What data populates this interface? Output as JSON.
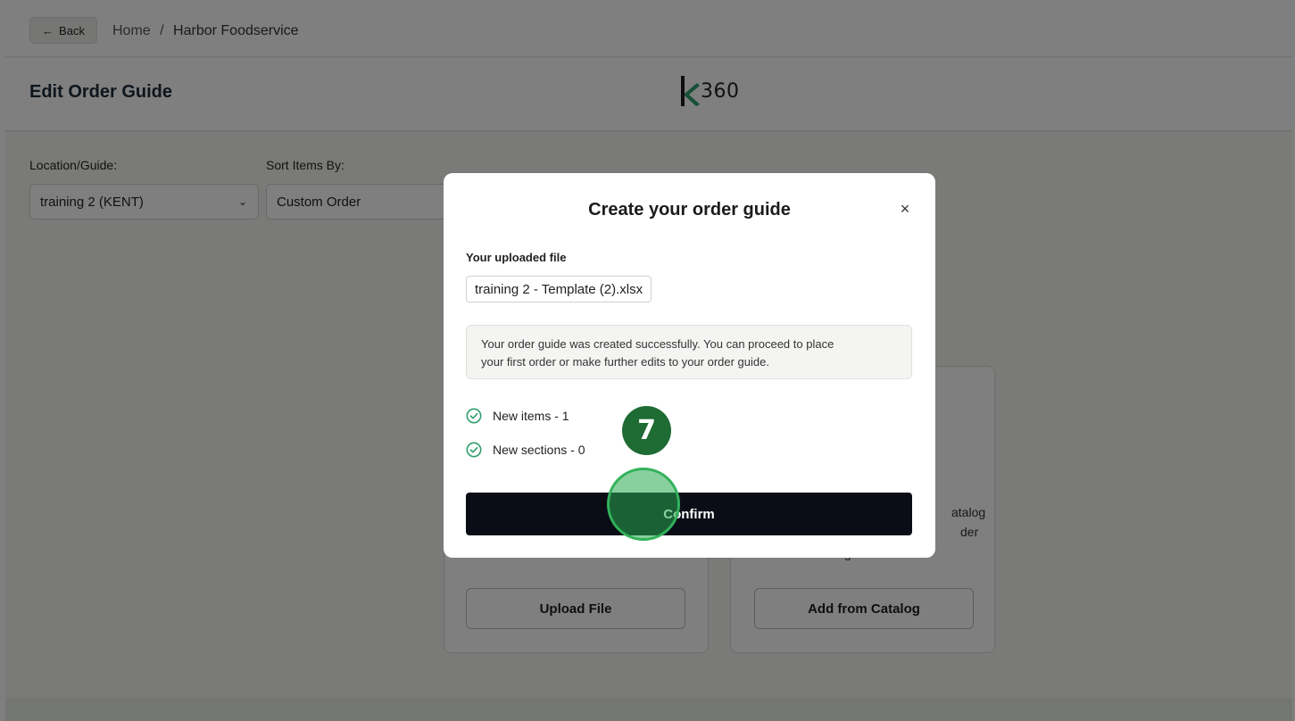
{
  "nav": {
    "back_label": "Back",
    "breadcrumb_home": "Home",
    "breadcrumb_sep": "/",
    "breadcrumb_current": "Harbor Foodservice"
  },
  "header": {
    "title": "Edit Order Guide",
    "logo_text": "360"
  },
  "filters": {
    "location_label": "Location/Guide:",
    "location_value": "training 2 (KENT)",
    "sort_label": "Sort Items By:",
    "sort_value": "Custom Order"
  },
  "cards": {
    "upload_button": "Upload File",
    "catalog_button": "Add from Catalog",
    "catalog_partial_text": [
      "atalog",
      "der",
      "guide."
    ]
  },
  "modal": {
    "title": "Create your order guide",
    "close_glyph": "×",
    "file_label": "Your uploaded file",
    "file_name": "training 2 - Template (2).xlsx",
    "notice_line1": "Your order guide was created successfully. You can proceed to place",
    "notice_line2": "your first order or make further edits to your order guide.",
    "stats": [
      {
        "label": "New items - 1",
        "icon": "check-circle-icon"
      },
      {
        "label": "New sections - 0",
        "icon": "check-circle-icon"
      }
    ],
    "confirm_label": "Confirm"
  },
  "tutorial": {
    "step_number": "7"
  },
  "colors": {
    "accent_green": "#2e9e6a",
    "confirm_bg": "#0b0d16",
    "step_badge": "#1e6b34"
  }
}
